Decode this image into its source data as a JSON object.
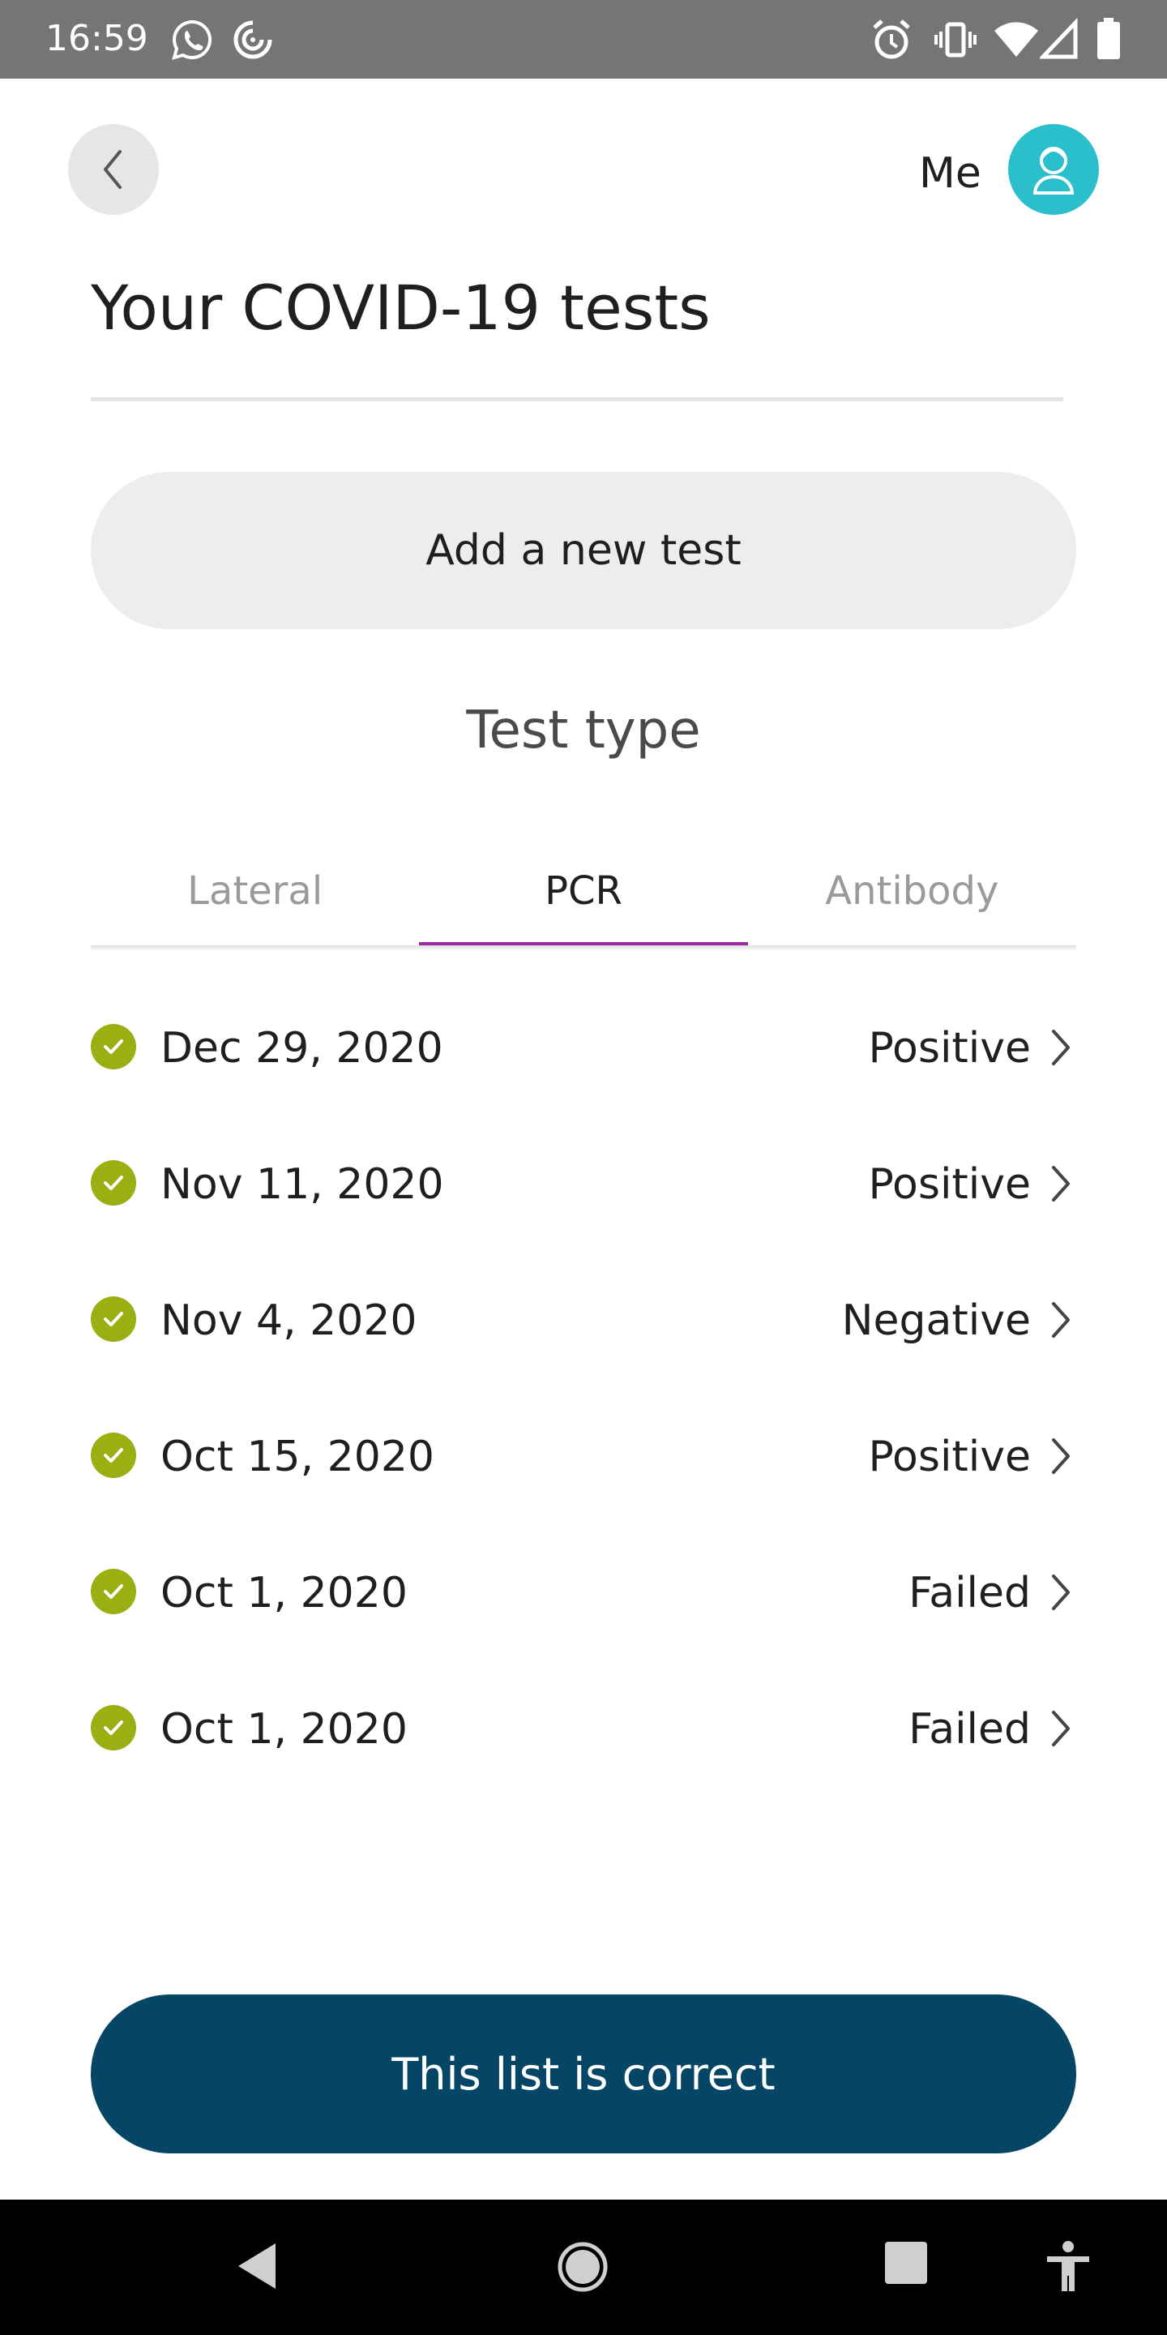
{
  "status_bar": {
    "time": "16:59",
    "left_icons": [
      "whatsapp-icon",
      "sync-icon"
    ],
    "right_icons": [
      "alarm-icon",
      "vibrate-icon",
      "wifi-icon",
      "signal-icon",
      "battery-icon"
    ]
  },
  "header": {
    "me_label": "Me",
    "title": "Your COVID-19 tests"
  },
  "add_test_label": "Add a new test",
  "test_type_heading": "Test type",
  "tabs": [
    {
      "label": "Lateral",
      "active": false
    },
    {
      "label": "PCR",
      "active": true
    },
    {
      "label": "Antibody",
      "active": false
    }
  ],
  "tests": [
    {
      "date": "Dec 29, 2020",
      "result": "Positive"
    },
    {
      "date": "Nov 11, 2020",
      "result": "Positive"
    },
    {
      "date": "Nov 4, 2020",
      "result": "Negative"
    },
    {
      "date": "Oct 15, 2020",
      "result": "Positive"
    },
    {
      "date": "Oct 1, 2020",
      "result": "Failed"
    },
    {
      "date": "Oct 1, 2020",
      "result": "Failed"
    }
  ],
  "confirm_label": "This list is correct",
  "colors": {
    "accent_tab": "#9c2aa0",
    "check": "#9aaf12",
    "avatar": "#2bbfcc",
    "primary_button": "#054565"
  }
}
